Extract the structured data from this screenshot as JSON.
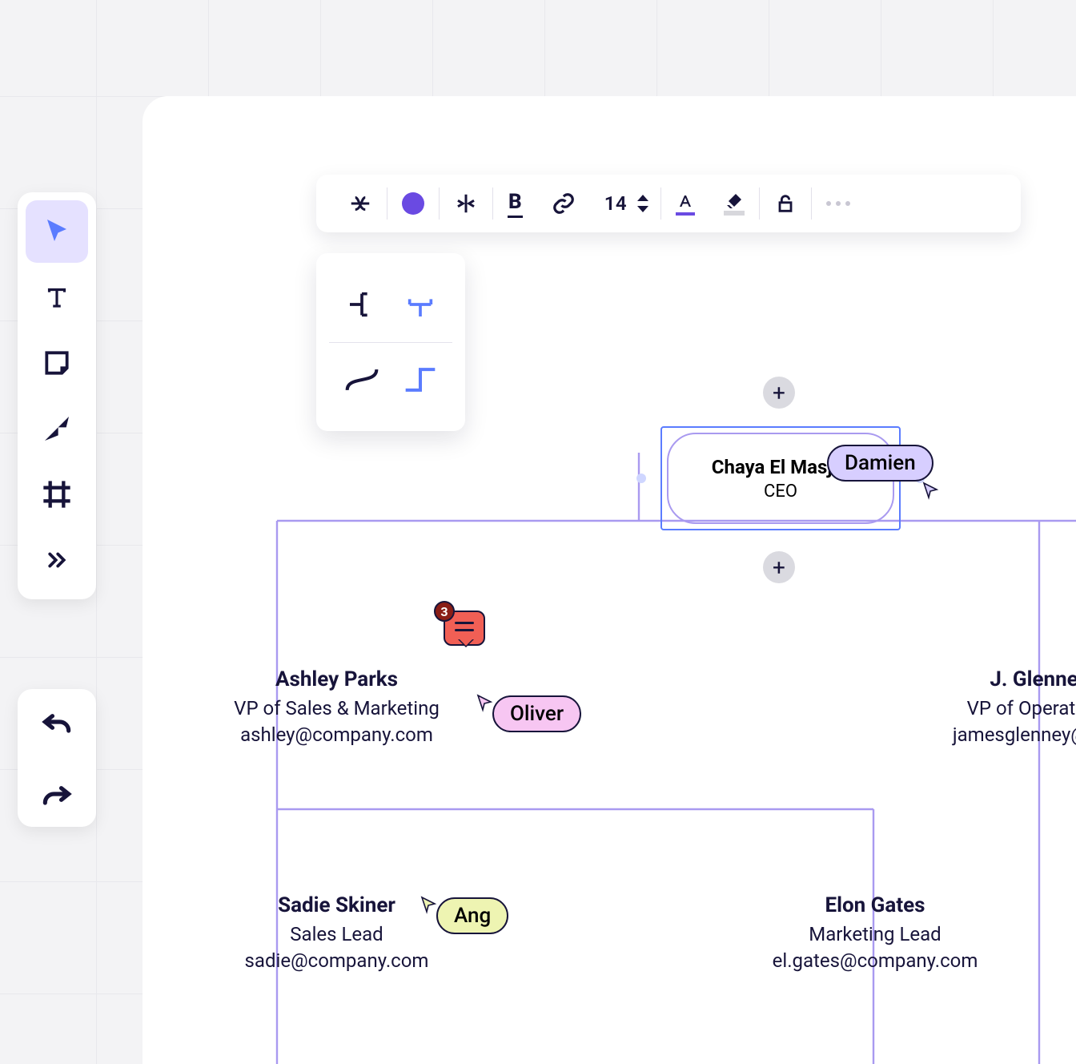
{
  "tools": {
    "select": "select-tool",
    "text": "text-tool",
    "note": "sticky-note-tool",
    "arrow": "arrow-tool",
    "frame": "frame-tool",
    "more": "more-tools"
  },
  "history": {
    "undo": "undo",
    "redo": "redo"
  },
  "format_bar": {
    "font_size": "14",
    "color": "#6a4ae2"
  },
  "line_popover": {
    "opts": [
      "left-branch",
      "top-branch",
      "curved",
      "stepped"
    ],
    "selected": "top-branch"
  },
  "nodes": {
    "ceo": {
      "name": "Chaya El Masjar",
      "role": "CEO"
    },
    "vp_sales": {
      "name": "Ashley Parks",
      "role": "VP of Sales & Marketing",
      "email": "ashley@company.com"
    },
    "vp_ops": {
      "name": "J. Glenney",
      "role": "VP of Operations",
      "email": "jamesglenney@com"
    },
    "sales_lead": {
      "name": "Sadie Skiner",
      "role": "Sales Lead",
      "email": "sadie@company.com"
    },
    "mkt_lead": {
      "name": "Elon Gates",
      "role": "Marketing Lead",
      "email": "el.gates@company.com"
    }
  },
  "collaborators": {
    "damien": "Damien",
    "oliver": "Oliver",
    "ang": "Ang"
  },
  "comment": {
    "count": "3"
  }
}
